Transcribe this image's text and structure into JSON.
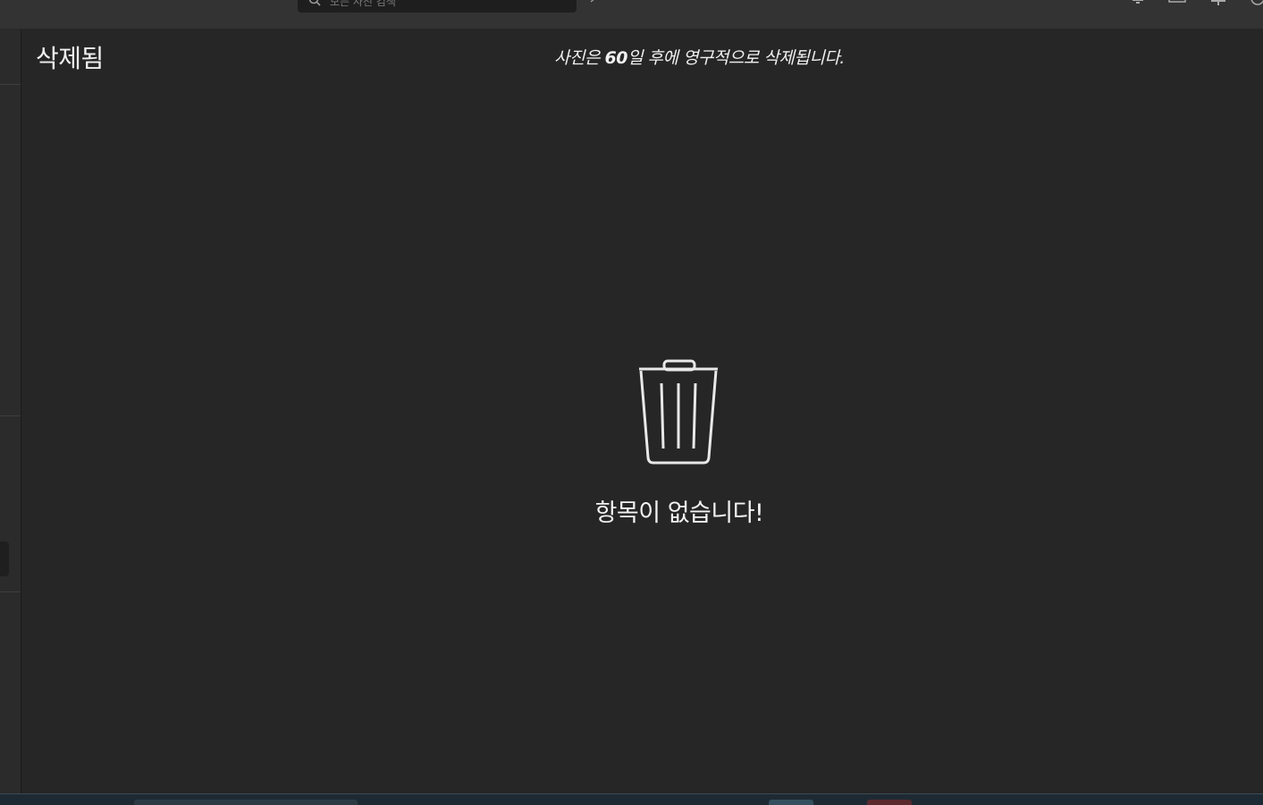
{
  "search": {
    "placeholder": "모든 사진 검색"
  },
  "page": {
    "title": "삭제됨",
    "retention_note_before": "사진은 ",
    "retention_days": "60",
    "retention_note_after": "일 후에 영구적으로 삭제됩니다."
  },
  "empty_state": {
    "icon": "trash-icon",
    "message": "항목이 없습니다!"
  },
  "colors": {
    "background": "#262626",
    "topbar": "#333333",
    "text": "#f2f2f2"
  }
}
